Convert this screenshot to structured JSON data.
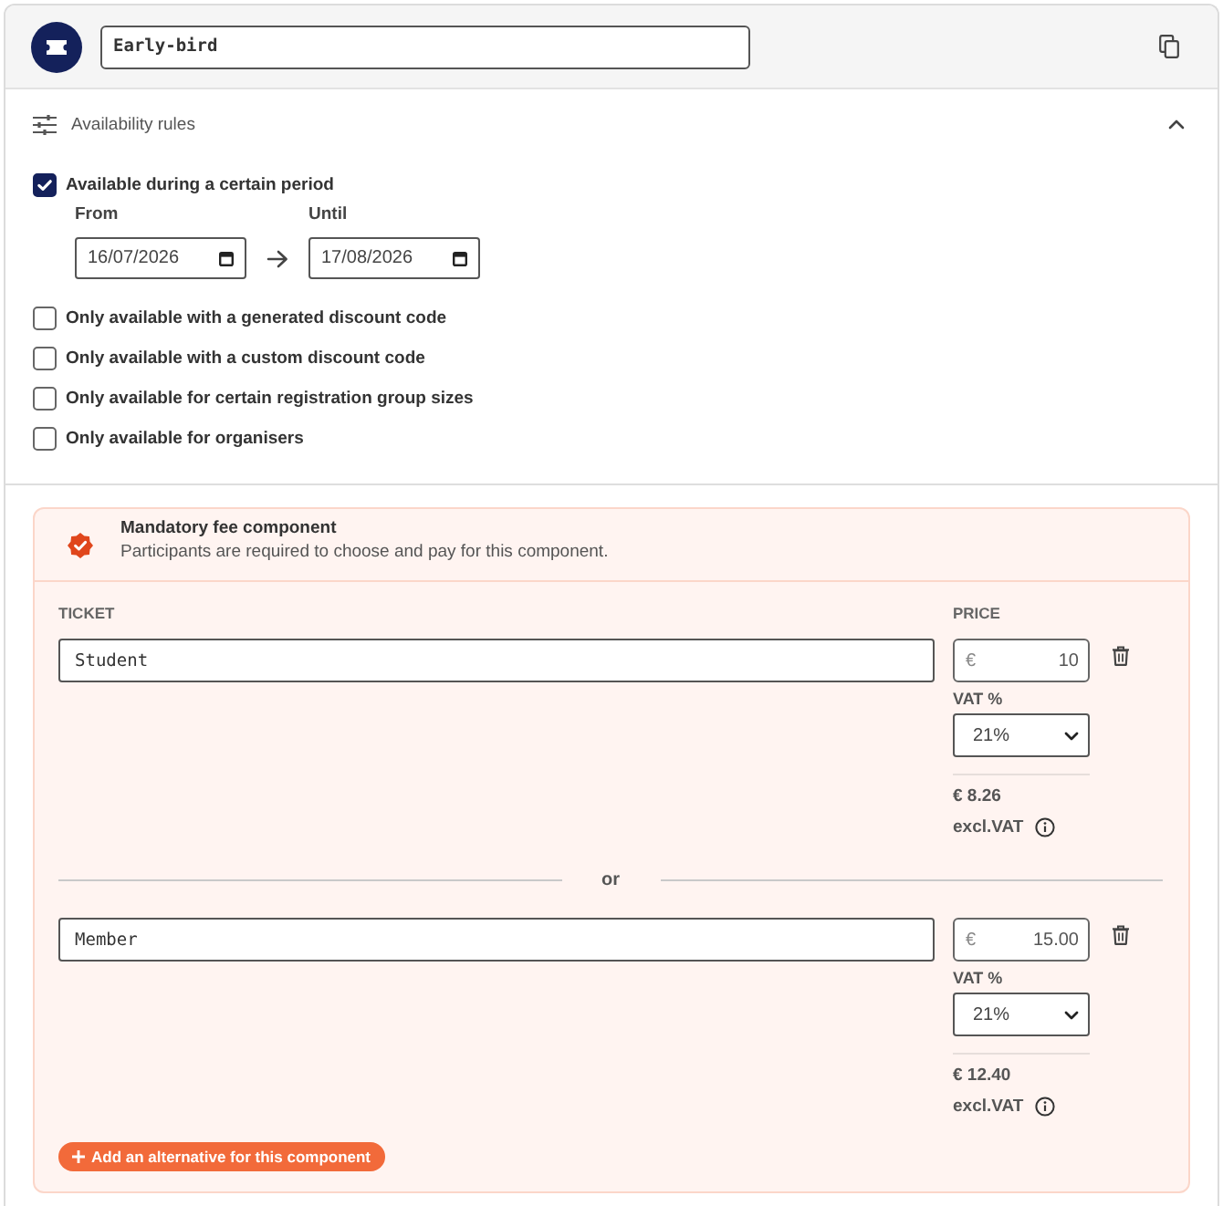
{
  "ticket": {
    "name": "Early-bird"
  },
  "availability": {
    "title": "Availability rules",
    "expanded": true,
    "rules": [
      {
        "label": "Available during a certain period",
        "checked": true,
        "period": {
          "from_label": "From",
          "from": "16/07/2026",
          "until_label": "Until",
          "until": "17/08/2026"
        }
      },
      {
        "label": "Only available with a generated discount code",
        "checked": false
      },
      {
        "label": "Only available with a custom discount code",
        "checked": false
      },
      {
        "label": "Only available for certain registration group sizes",
        "checked": false
      },
      {
        "label": "Only available for organisers",
        "checked": false
      }
    ]
  },
  "fee_component": {
    "title": "Mandatory fee component",
    "description": "Participants are required to choose and pay for this component.",
    "columns": [
      "TICKET",
      "PRICE"
    ],
    "options": [
      {
        "name": "Student",
        "currency": "€",
        "price": "10",
        "vat_label": "VAT %",
        "vat": "21%",
        "net_price": "€ 8.26",
        "net_label": "excl.VAT"
      },
      {
        "name": "Member",
        "currency": "€",
        "price": "15.00",
        "vat_label": "VAT %",
        "vat": "21%",
        "net_price": "€ 12.40",
        "net_label": "excl.VAT"
      }
    ],
    "separator": "or",
    "add_button": "Add an alternative for this component"
  }
}
